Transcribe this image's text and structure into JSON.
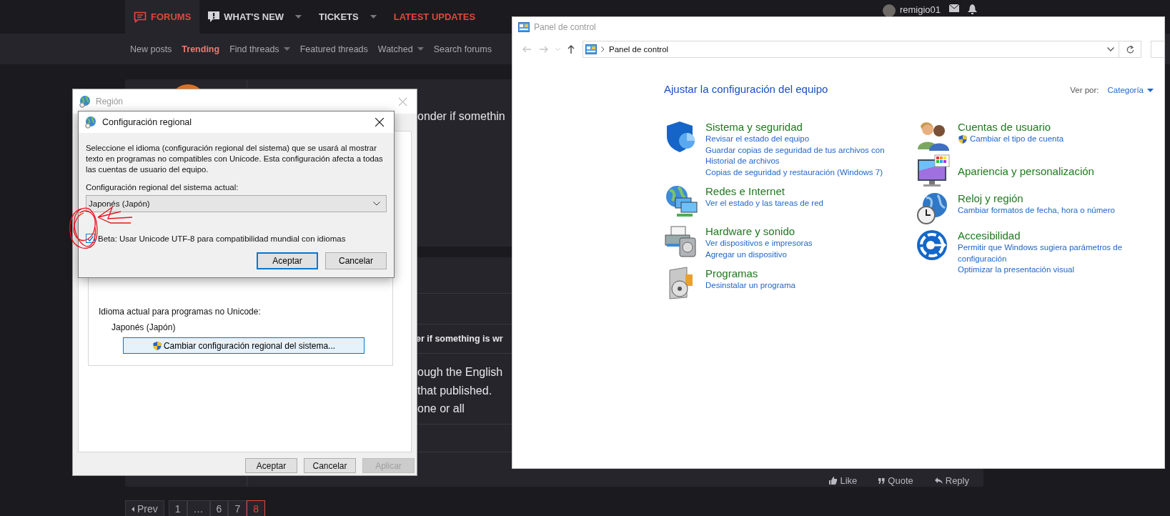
{
  "forum": {
    "nav": [
      {
        "label": "FORUMS",
        "kind": "speech",
        "selected": true,
        "dropdown": false,
        "color": "#e0483c"
      },
      {
        "label": "WHAT'S NEW",
        "kind": "alert",
        "selected": false,
        "dropdown": true,
        "color": "#d6d6da"
      },
      {
        "label": "TICKETS",
        "kind": "plain",
        "selected": false,
        "dropdown": true,
        "color": "#d6d6da"
      },
      {
        "label": "LATEST UPDATES",
        "kind": "plain",
        "selected": false,
        "dropdown": false,
        "color": "#e0483c"
      }
    ],
    "user": {
      "name": "remigio01"
    },
    "subnav": [
      {
        "label": "New posts",
        "selected": false,
        "dropdown": false
      },
      {
        "label": "Trending",
        "selected": true,
        "dropdown": false
      },
      {
        "label": "Find threads",
        "selected": false,
        "dropdown": true
      },
      {
        "label": "Featured threads",
        "selected": false,
        "dropdown": false
      },
      {
        "label": "Watched",
        "selected": false,
        "dropdown": true
      },
      {
        "label": "Search forums",
        "selected": false,
        "dropdown": false
      }
    ],
    "posts": [
      {
        "lines": [
          "onder if somethin"
        ]
      },
      {
        "quote": "er if something is wr",
        "lines": [
          "ough the English",
          "that published.",
          "one or all"
        ],
        "actions": [
          "Like",
          "Quote",
          "Reply"
        ]
      }
    ],
    "pagination": {
      "prev": "Prev",
      "pages": [
        {
          "label": "1",
          "selected": false
        },
        {
          "label": "…",
          "selected": false
        },
        {
          "label": "6",
          "selected": false
        },
        {
          "label": "7",
          "selected": false
        },
        {
          "label": "8",
          "selected": true
        }
      ]
    }
  },
  "region_window": {
    "title": "Región",
    "current_language_label": "Idioma actual para programas no Unicode:",
    "current_language": "Japonés (Japón)",
    "change_button": "Cambiar configuración regional del sistema...",
    "buttons": [
      {
        "label": "Aceptar",
        "disabled": false
      },
      {
        "label": "Cancelar",
        "disabled": false
      },
      {
        "label": "Aplicar",
        "disabled": true
      }
    ]
  },
  "locale_dialog": {
    "title": "Configuración regional",
    "description": "Seleccione el idioma (configuración regional del sistema) que se usará al mostrar texto en programas no compatibles con Unicode. Esta configuración afecta a todas las cuentas de usuario del equipo.",
    "locale_label": "Configuración regional del sistema actual:",
    "locale_value": "Japonés (Japón)",
    "utf8_option": {
      "label": "Beta: Usar Unicode UTF-8 para compatibilidad mundial con idiomas",
      "checked": true
    },
    "buttons": [
      {
        "label": "Aceptar",
        "default": true
      },
      {
        "label": "Cancelar",
        "default": false
      }
    ]
  },
  "control_panel": {
    "title": "Panel de control",
    "breadcrumb": "Panel de control",
    "heading": "Ajustar la configuración del equipo",
    "view_by_label": "Ver por:",
    "view_by_value": "Categoría",
    "columns": [
      [
        {
          "title": "Sistema y seguridad",
          "links": [
            {
              "label": "Revisar el estado del equipo",
              "shield": false
            },
            {
              "label": "Guardar copias de seguridad de tus archivos con Historial de archivos",
              "shield": false
            },
            {
              "label": "Copias de seguridad y restauración (Windows 7)",
              "shield": false
            }
          ]
        },
        {
          "title": "Redes e Internet",
          "links": [
            {
              "label": "Ver el estado y las tareas de red",
              "shield": false
            }
          ]
        },
        {
          "title": "Hardware y sonido",
          "links": [
            {
              "label": "Ver dispositivos e impresoras",
              "shield": false
            },
            {
              "label": "Agregar un dispositivo",
              "shield": false
            }
          ]
        },
        {
          "title": "Programas",
          "links": [
            {
              "label": "Desinstalar un programa",
              "shield": false
            }
          ]
        }
      ],
      [
        {
          "title": "Cuentas de usuario",
          "links": [
            {
              "label": "Cambiar el tipo de cuenta",
              "shield": true
            }
          ]
        },
        {
          "title": "Apariencia y personalización"
        },
        {
          "title": "Reloj y región",
          "links": [
            {
              "label": "Cambiar formatos de fecha, hora o número",
              "shield": false
            }
          ]
        },
        {
          "title": "Accesibilidad",
          "links": [
            {
              "label": "Permitir que Windows sugiera parámetros de configuración",
              "shield": false
            },
            {
              "label": "Optimizar la presentación visual",
              "shield": false
            }
          ]
        }
      ]
    ]
  }
}
